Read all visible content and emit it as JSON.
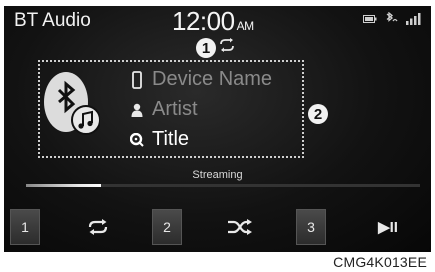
{
  "status_bar": {
    "title": "BT Audio",
    "time": "12:00",
    "ampm": "AM",
    "icons": [
      "battery-icon",
      "bluetooth-phone-icon",
      "signal-icon"
    ]
  },
  "callouts": {
    "marker_1": "1",
    "marker_2": "2"
  },
  "track": {
    "device_name": "Device Name",
    "artist": "Artist",
    "title": "Title",
    "dimmed_color": "#8a8a8a",
    "active_color": "#ffffff"
  },
  "playback": {
    "status": "Streaming",
    "progress": 0.19
  },
  "controls": {
    "preset_1": "1",
    "repeat_icon": "repeat-icon",
    "preset_2": "2",
    "shuffle_icon": "shuffle-icon",
    "preset_3": "3",
    "play_pause": "▶II"
  },
  "caption": "CMG4K013EE"
}
